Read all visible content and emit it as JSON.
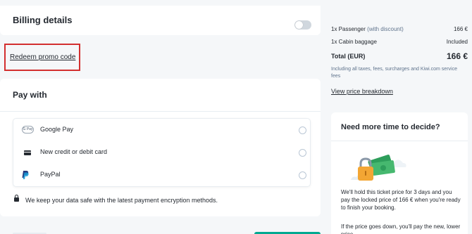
{
  "billing": {
    "title": "Billing details"
  },
  "promo": {
    "label": "Redeem promo code"
  },
  "payment": {
    "title": "Pay with",
    "methods": [
      {
        "label": "Google Pay",
        "icon": "google-pay-icon"
      },
      {
        "label": "New credit or debit card",
        "icon": "credit-card-icon"
      },
      {
        "label": "PayPal",
        "icon": "paypal-icon"
      }
    ],
    "gpay_badge": "G Pay",
    "security_note": "We keep your data safe with the latest payment encryption methods."
  },
  "summary": {
    "passenger_label": "1x Passenger",
    "passenger_discount": "(with discount)",
    "passenger_price": "166 €",
    "baggage_label": "1x Cabin baggage",
    "baggage_value": "Included",
    "total_label": "Total (EUR)",
    "total_value": "166 €",
    "fine_print": "Including all taxes, fees, surcharges and Kiwi.com service fees",
    "breakdown_link": "View price breakdown"
  },
  "decide": {
    "title": "Need more time to decide?",
    "p1": "We'll hold this ticket price for 3 days and you pay the locked price of 166 € when you're ready to finish your booking.",
    "p2": "If the price goes down, you'll pay the new, lower price."
  },
  "colors": {
    "accent": "#00a991",
    "highlight": "#d32f2f",
    "text": "#252a31",
    "muted": "#5f738c"
  }
}
